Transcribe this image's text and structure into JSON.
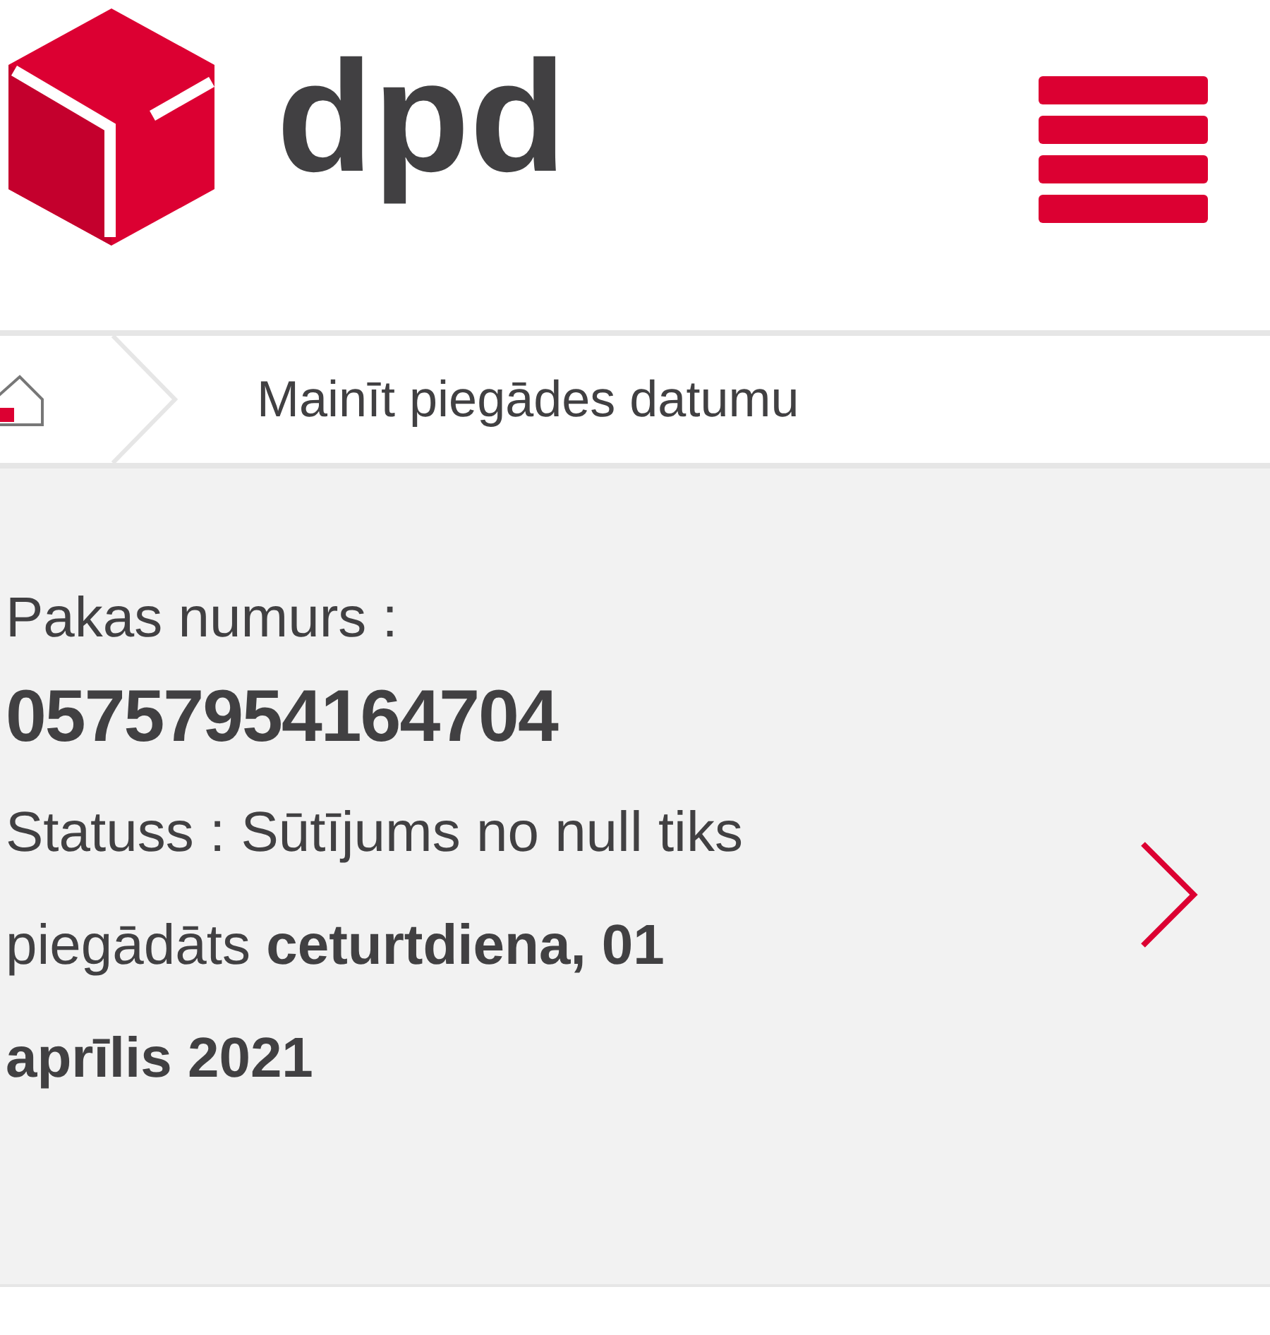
{
  "header": {
    "logo_text": "dpd"
  },
  "breadcrumb": {
    "current": "Mainīt piegādes datumu"
  },
  "parcel": {
    "number_label": "Pakas numurs :",
    "number": "05757954164704",
    "status": "Statuss : Sūtījums no null tiks piegādāts **ceturtdiena, 01 aprīlis 2021**"
  }
}
